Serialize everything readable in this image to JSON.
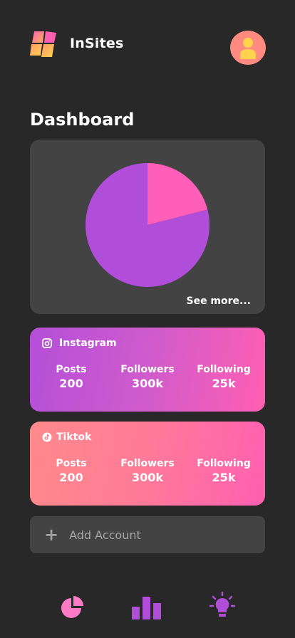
{
  "app": {
    "title": "InSites"
  },
  "page": {
    "title": "Dashboard"
  },
  "chart_card": {
    "see_more_label": "See more..."
  },
  "chart_data": {
    "type": "pie",
    "title": "",
    "values": [
      21,
      79
    ],
    "colors": [
      "#ff5fb8",
      "#b04dd9"
    ]
  },
  "accounts": [
    {
      "name": "Instagram",
      "icon": "instagram-icon",
      "stats": [
        {
          "label": "Posts",
          "value": "200"
        },
        {
          "label": "Followers",
          "value": "300k"
        },
        {
          "label": "Following",
          "value": "25k"
        }
      ]
    },
    {
      "name": "Tiktok",
      "icon": "tiktok-icon",
      "stats": [
        {
          "label": "Posts",
          "value": "200"
        },
        {
          "label": "Followers",
          "value": "300k"
        },
        {
          "label": "Following",
          "value": "25k"
        }
      ]
    }
  ],
  "add_account": {
    "label": "Add Account"
  },
  "bottom_nav": {
    "items": [
      {
        "icon": "pie-chart-icon"
      },
      {
        "icon": "bar-chart-icon"
      },
      {
        "icon": "lightbulb-icon"
      }
    ]
  },
  "colors": {
    "background": "#282828",
    "card": "#434343",
    "pink": "#ff5fb8",
    "purple": "#b04dd9",
    "accent_yellow": "#ffd34d"
  }
}
